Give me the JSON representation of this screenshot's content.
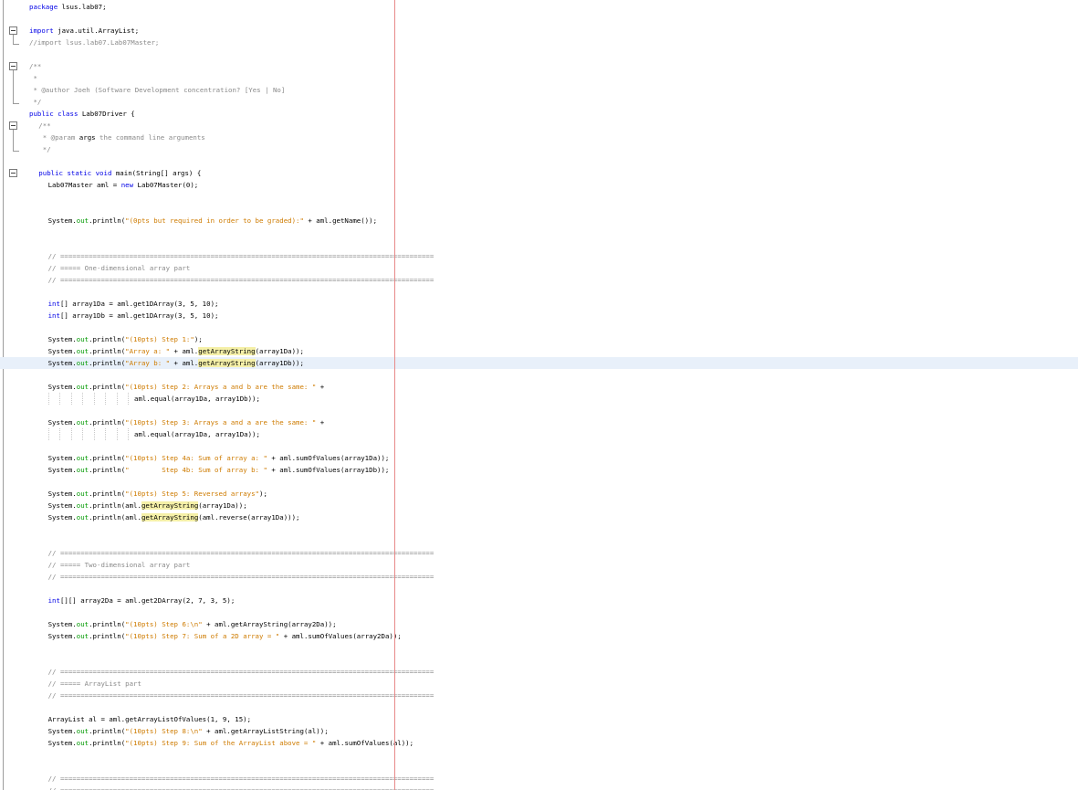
{
  "editor": {
    "colors": {
      "background": "#ffffff",
      "keyword": "#0000e6",
      "comment": "#8a8a8a",
      "string": "#ce7b00",
      "field": "#009900",
      "highlight": "#f5f0a8",
      "current_line": "#e8f0fa",
      "right_margin": "#e88a8a"
    },
    "current_line_index": 30,
    "lines": [
      {
        "indent": 0,
        "fold": "",
        "tokens": [
          {
            "k": "kw",
            "t": "package"
          },
          {
            "t": " lsus.lab07;"
          }
        ]
      },
      {
        "indent": 0,
        "fold": "",
        "tokens": []
      },
      {
        "indent": 0,
        "fold": "start",
        "tokens": [
          {
            "k": "kw",
            "t": "import"
          },
          {
            "t": " java.util.ArrayList;"
          }
        ]
      },
      {
        "indent": 0,
        "fold": "end",
        "tokens": [
          {
            "k": "cm",
            "t": "//import lsus.lab07.Lab07Master;"
          }
        ]
      },
      {
        "indent": 0,
        "fold": "",
        "tokens": []
      },
      {
        "indent": 0,
        "fold": "start",
        "tokens": [
          {
            "k": "cm",
            "t": "/**"
          }
        ]
      },
      {
        "indent": 0,
        "fold": "",
        "tokens": [
          {
            "k": "cm",
            "t": " *"
          }
        ]
      },
      {
        "indent": 0,
        "fold": "",
        "tokens": [
          {
            "k": "cm",
            "t": " * @author Joeh (Software Development concentration? [Yes | No]"
          }
        ]
      },
      {
        "indent": 0,
        "fold": "end",
        "tokens": [
          {
            "k": "cm",
            "t": " */"
          }
        ]
      },
      {
        "indent": 0,
        "fold": "",
        "tokens": [
          {
            "k": "kw",
            "t": "public class"
          },
          {
            "t": " Lab07Driver {"
          }
        ]
      },
      {
        "indent": 1,
        "fold": "start",
        "tokens": [
          {
            "k": "cm",
            "t": "/**"
          }
        ]
      },
      {
        "indent": 1,
        "fold": "",
        "tokens": [
          {
            "k": "cm",
            "t": " * @param "
          },
          {
            "t": "args"
          },
          {
            "k": "cm",
            "t": " the command line arguments"
          }
        ]
      },
      {
        "indent": 1,
        "fold": "end",
        "tokens": [
          {
            "k": "cm",
            "t": " */"
          }
        ]
      },
      {
        "indent": 0,
        "fold": "",
        "tokens": []
      },
      {
        "indent": 1,
        "fold": "start",
        "tokens": [
          {
            "k": "kw",
            "t": "public static void"
          },
          {
            "t": " main(String[] args) {"
          }
        ]
      },
      {
        "indent": 2,
        "fold": "",
        "tokens": [
          {
            "t": "Lab07Master aml = "
          },
          {
            "k": "kw",
            "t": "new"
          },
          {
            "t": " Lab07Master(0);"
          }
        ]
      },
      {
        "indent": 0,
        "fold": "",
        "tokens": []
      },
      {
        "indent": 0,
        "fold": "",
        "tokens": []
      },
      {
        "indent": 2,
        "fold": "",
        "tokens": [
          {
            "t": "System."
          },
          {
            "k": "fld",
            "t": "out"
          },
          {
            "t": ".println("
          },
          {
            "k": "st",
            "t": "\"(0pts but required in order to be graded):\""
          },
          {
            "t": " + aml.getName());"
          }
        ]
      },
      {
        "indent": 0,
        "fold": "",
        "tokens": []
      },
      {
        "indent": 0,
        "fold": "",
        "tokens": []
      },
      {
        "indent": 2,
        "fold": "",
        "tokens": [
          {
            "k": "cm",
            "t": "// ============================================================================================"
          }
        ]
      },
      {
        "indent": 2,
        "fold": "",
        "tokens": [
          {
            "k": "cm",
            "t": "// ===== One-dimensional array part"
          }
        ]
      },
      {
        "indent": 2,
        "fold": "",
        "tokens": [
          {
            "k": "cm",
            "t": "// ============================================================================================"
          }
        ]
      },
      {
        "indent": 0,
        "fold": "",
        "tokens": []
      },
      {
        "indent": 2,
        "fold": "",
        "tokens": [
          {
            "k": "kw",
            "t": "int"
          },
          {
            "t": "[] array1Da = aml.get1DArray(3, 5, 10);"
          }
        ]
      },
      {
        "indent": 2,
        "fold": "",
        "tokens": [
          {
            "k": "kw",
            "t": "int"
          },
          {
            "t": "[] array1Db = aml.get1DArray(3, 5, 10);"
          }
        ]
      },
      {
        "indent": 0,
        "fold": "",
        "tokens": []
      },
      {
        "indent": 2,
        "fold": "",
        "tokens": [
          {
            "t": "System."
          },
          {
            "k": "fld",
            "t": "out"
          },
          {
            "t": ".println("
          },
          {
            "k": "st",
            "t": "\"(10pts) Step 1:\""
          },
          {
            "t": ");"
          }
        ]
      },
      {
        "indent": 2,
        "fold": "",
        "tokens": [
          {
            "t": "System."
          },
          {
            "k": "fld",
            "t": "out"
          },
          {
            "t": ".println("
          },
          {
            "k": "st",
            "t": "\"Array a: \""
          },
          {
            "t": " + aml."
          },
          {
            "k": "sel",
            "t": "getArrayString"
          },
          {
            "t": "(array1Da));"
          }
        ]
      },
      {
        "indent": 2,
        "fold": "",
        "tokens": [
          {
            "t": "System."
          },
          {
            "k": "fld",
            "t": "out"
          },
          {
            "t": ".println("
          },
          {
            "k": "st",
            "t": "\"Array b: \""
          },
          {
            "t": " + aml."
          },
          {
            "k": "sel",
            "t": "getArrayString"
          },
          {
            "t": "(array1Db));"
          }
        ]
      },
      {
        "indent": 0,
        "fold": "",
        "tokens": []
      },
      {
        "indent": 2,
        "fold": "",
        "tokens": [
          {
            "t": "System."
          },
          {
            "k": "fld",
            "t": "out"
          },
          {
            "t": ".println("
          },
          {
            "k": "st",
            "t": "\"(10pts) Step 2: Arrays a and b are the same: \""
          },
          {
            "t": " +"
          }
        ]
      },
      {
        "indent": 2,
        "fold": "",
        "cont": true,
        "tokens": [
          {
            "t": "aml.equal(array1Da, array1Db));"
          }
        ]
      },
      {
        "indent": 0,
        "fold": "",
        "tokens": []
      },
      {
        "indent": 2,
        "fold": "",
        "tokens": [
          {
            "t": "System."
          },
          {
            "k": "fld",
            "t": "out"
          },
          {
            "t": ".println("
          },
          {
            "k": "st",
            "t": "\"(10pts) Step 3: Arrays a and a are the same: \""
          },
          {
            "t": " +"
          }
        ]
      },
      {
        "indent": 2,
        "fold": "",
        "cont": true,
        "tokens": [
          {
            "t": "aml.equal(array1Da, array1Da));"
          }
        ]
      },
      {
        "indent": 0,
        "fold": "",
        "tokens": []
      },
      {
        "indent": 2,
        "fold": "",
        "tokens": [
          {
            "t": "System."
          },
          {
            "k": "fld",
            "t": "out"
          },
          {
            "t": ".println("
          },
          {
            "k": "st",
            "t": "\"(10pts) Step 4a: Sum of array a: \""
          },
          {
            "t": " + aml.sumOfValues(array1Da));"
          }
        ]
      },
      {
        "indent": 2,
        "fold": "",
        "tokens": [
          {
            "t": "System."
          },
          {
            "k": "fld",
            "t": "out"
          },
          {
            "t": ".println("
          },
          {
            "k": "st",
            "t": "\"        Step 4b: Sum of array b: \""
          },
          {
            "t": " + aml.sumOfValues(array1Db));"
          }
        ]
      },
      {
        "indent": 0,
        "fold": "",
        "tokens": []
      },
      {
        "indent": 2,
        "fold": "",
        "tokens": [
          {
            "t": "System."
          },
          {
            "k": "fld",
            "t": "out"
          },
          {
            "t": ".println("
          },
          {
            "k": "st",
            "t": "\"(10pts) Step 5: Reversed arrays\""
          },
          {
            "t": ");"
          }
        ]
      },
      {
        "indent": 2,
        "fold": "",
        "tokens": [
          {
            "t": "System."
          },
          {
            "k": "fld",
            "t": "out"
          },
          {
            "t": ".println(aml."
          },
          {
            "k": "sel",
            "t": "getArrayString"
          },
          {
            "t": "(array1Da));"
          }
        ]
      },
      {
        "indent": 2,
        "fold": "",
        "tokens": [
          {
            "t": "System."
          },
          {
            "k": "fld",
            "t": "out"
          },
          {
            "t": ".println(aml."
          },
          {
            "k": "sel",
            "t": "getArrayString"
          },
          {
            "t": "(aml.reverse(array1Da)));"
          }
        ]
      },
      {
        "indent": 0,
        "fold": "",
        "tokens": []
      },
      {
        "indent": 0,
        "fold": "",
        "tokens": []
      },
      {
        "indent": 2,
        "fold": "",
        "tokens": [
          {
            "k": "cm",
            "t": "// ============================================================================================"
          }
        ]
      },
      {
        "indent": 2,
        "fold": "",
        "tokens": [
          {
            "k": "cm",
            "t": "// ===== Two-dimensional array part"
          }
        ]
      },
      {
        "indent": 2,
        "fold": "",
        "tokens": [
          {
            "k": "cm",
            "t": "// ============================================================================================"
          }
        ]
      },
      {
        "indent": 0,
        "fold": "",
        "tokens": []
      },
      {
        "indent": 2,
        "fold": "",
        "tokens": [
          {
            "k": "kw",
            "t": "int"
          },
          {
            "t": "[][] array2Da = aml.get2DArray(2, 7, 3, 5);"
          }
        ]
      },
      {
        "indent": 0,
        "fold": "",
        "tokens": []
      },
      {
        "indent": 2,
        "fold": "",
        "tokens": [
          {
            "t": "System."
          },
          {
            "k": "fld",
            "t": "out"
          },
          {
            "t": ".println("
          },
          {
            "k": "st",
            "t": "\"(10pts) Step 6:\\n\""
          },
          {
            "t": " + aml.getArrayString(array2Da));"
          }
        ]
      },
      {
        "indent": 2,
        "fold": "",
        "tokens": [
          {
            "t": "System."
          },
          {
            "k": "fld",
            "t": "out"
          },
          {
            "t": ".println("
          },
          {
            "k": "st",
            "t": "\"(10pts) Step 7: Sum of a 2D array = \""
          },
          {
            "t": " + aml.sumOfValues(array2Da));"
          }
        ]
      },
      {
        "indent": 0,
        "fold": "",
        "tokens": []
      },
      {
        "indent": 0,
        "fold": "",
        "tokens": []
      },
      {
        "indent": 2,
        "fold": "",
        "tokens": [
          {
            "k": "cm",
            "t": "// ============================================================================================"
          }
        ]
      },
      {
        "indent": 2,
        "fold": "",
        "tokens": [
          {
            "k": "cm",
            "t": "// ===== ArrayList part"
          }
        ]
      },
      {
        "indent": 2,
        "fold": "",
        "tokens": [
          {
            "k": "cm",
            "t": "// ============================================================================================"
          }
        ]
      },
      {
        "indent": 0,
        "fold": "",
        "tokens": []
      },
      {
        "indent": 2,
        "fold": "",
        "tokens": [
          {
            "t": "ArrayList al = aml.getArrayListOfValues(1, 9, 15);"
          }
        ]
      },
      {
        "indent": 2,
        "fold": "",
        "tokens": [
          {
            "t": "System."
          },
          {
            "k": "fld",
            "t": "out"
          },
          {
            "t": ".println("
          },
          {
            "k": "st",
            "t": "\"(10pts) Step 8:\\n\""
          },
          {
            "t": " + aml.getArrayListString(al));"
          }
        ]
      },
      {
        "indent": 2,
        "fold": "",
        "tokens": [
          {
            "t": "System."
          },
          {
            "k": "fld",
            "t": "out"
          },
          {
            "t": ".println("
          },
          {
            "k": "st",
            "t": "\"(10pts) Step 9: Sum of the ArrayList above = \""
          },
          {
            "t": " + aml.sumOfValues(al));"
          }
        ]
      },
      {
        "indent": 0,
        "fold": "",
        "tokens": []
      },
      {
        "indent": 0,
        "fold": "",
        "tokens": []
      },
      {
        "indent": 2,
        "fold": "",
        "tokens": [
          {
            "k": "cm",
            "t": "// ============================================================================================"
          }
        ]
      },
      {
        "indent": 2,
        "fold": "",
        "tokens": [
          {
            "k": "cm",
            "t": "// ============================================================================================"
          }
        ]
      }
    ]
  }
}
